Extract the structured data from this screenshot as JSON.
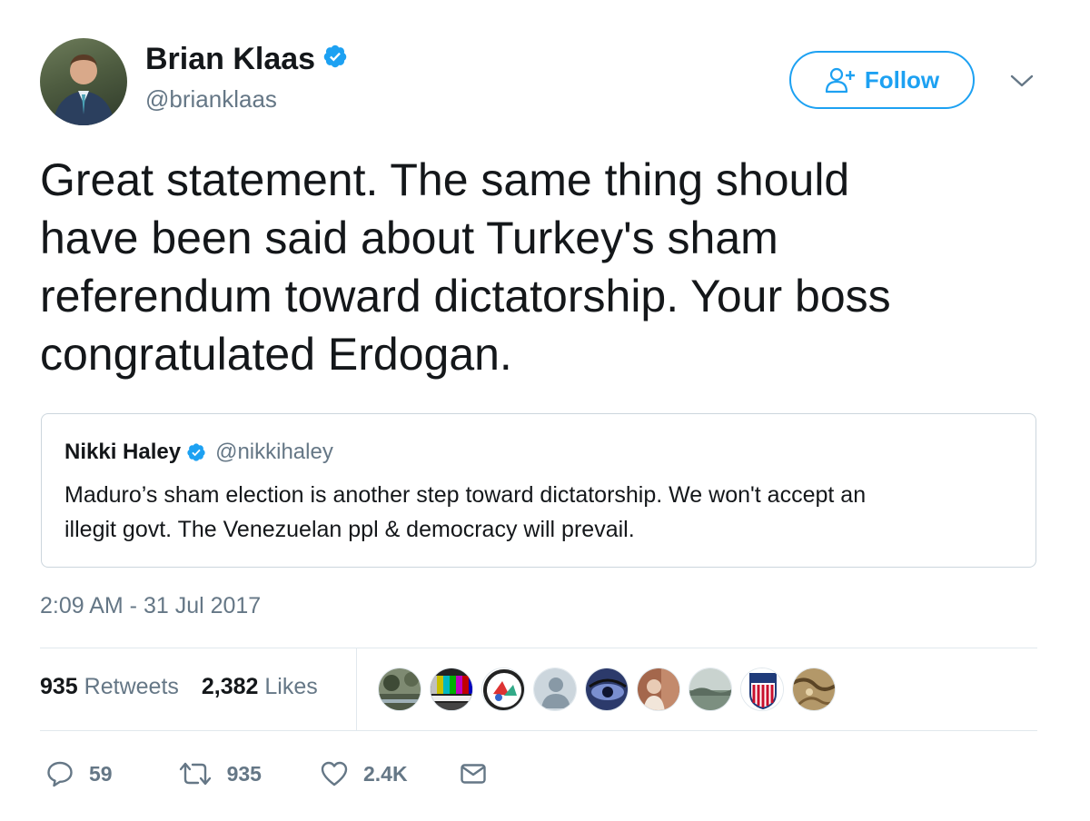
{
  "author": {
    "display_name": "Brian Klaas",
    "handle": "@brianklaas",
    "verified": true
  },
  "follow_button": {
    "label": "Follow",
    "icon": "add-user-icon"
  },
  "menu_icon": "chevron-down-icon",
  "tweet": {
    "text_lines": [
      "Great statement. The same thing should",
      "have been said about Turkey's sham",
      "referendum toward dictatorship. Your boss",
      "congratulated Erdogan."
    ],
    "timestamp": "2:09 AM - 31 Jul 2017"
  },
  "quoted_tweet": {
    "display_name": "Nikki Haley",
    "handle": "@nikkihaley",
    "verified": true,
    "text_lines": [
      "Maduro’s sham election is another step toward dictatorship. We won't accept an",
      "illegit govt. The Venezuelan ppl & democracy will prevail."
    ]
  },
  "stats": {
    "retweets_count": "935",
    "retweets_label": "Retweets",
    "likes_count": "2,382",
    "likes_label": "Likes"
  },
  "liker_avatars": [
    "landscape",
    "test-pattern",
    "logo-badge",
    "default-person",
    "eye-closeup",
    "person-portrait",
    "scenery",
    "usa-crest",
    "map-texture"
  ],
  "actions": {
    "reply": {
      "icon": "reply-icon",
      "count": "59"
    },
    "retweet": {
      "icon": "retweet-icon",
      "count": "935"
    },
    "like": {
      "icon": "heart-icon",
      "count": "2.4K"
    },
    "message": {
      "icon": "envelope-icon"
    }
  },
  "colors": {
    "accent": "#1da1f2",
    "text": "#14171a",
    "secondary": "#657786",
    "border": "#e1e8ed"
  }
}
